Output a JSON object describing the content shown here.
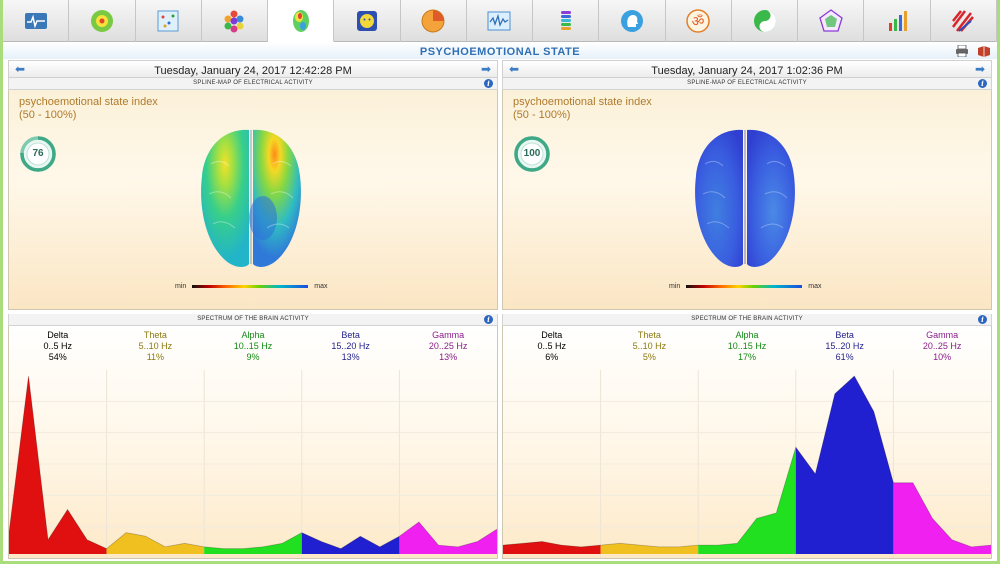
{
  "header": {
    "title": "PSYCHOEMOTIONAL STATE"
  },
  "toolbar": {
    "items": [
      {
        "icon": "ecg-monitor-icon"
      },
      {
        "icon": "aura-circle-icon"
      },
      {
        "icon": "scatter-grid-icon"
      },
      {
        "icon": "hexagon-cluster-icon"
      },
      {
        "icon": "brain-map-icon"
      },
      {
        "icon": "face-portrait-icon"
      },
      {
        "icon": "pie-chart-icon"
      },
      {
        "icon": "waveform-icon"
      },
      {
        "icon": "chakra-stack-icon"
      },
      {
        "icon": "head-profile-icon"
      },
      {
        "icon": "om-symbol-icon"
      },
      {
        "icon": "yin-yang-icon"
      },
      {
        "icon": "pentagon-star-icon"
      },
      {
        "icon": "bar-chart-icon"
      },
      {
        "icon": "pattern-icon"
      }
    ],
    "active_index": 4
  },
  "panels": [
    {
      "date": "Tuesday, January 24, 2017 12:42:28 PM",
      "map_heading": "SPLINE-MAP OF ELECTRICAL ACTIVITY",
      "index_label": "psychoemotional state index",
      "index_range": "(50 - 100%)",
      "index_value": "76",
      "index_fraction": 0.76,
      "scale_min": "min",
      "scale_max": "max",
      "spectrum_heading": "SPECTRUM OF THE BRAIN ACTIVITY",
      "bands": [
        {
          "name": "Delta",
          "range": "0..5 Hz",
          "pct": "54%",
          "color": "#000000"
        },
        {
          "name": "Theta",
          "range": "5..10 Hz",
          "pct": "11%",
          "color": "#8a7a10"
        },
        {
          "name": "Alpha",
          "range": "10..15 Hz",
          "pct": "9%",
          "color": "#138a13"
        },
        {
          "name": "Beta",
          "range": "15..20 Hz",
          "pct": "13%",
          "color": "#1e1e8a"
        },
        {
          "name": "Gamma",
          "range": "20..25 Hz",
          "pct": "13%",
          "color": "#8a1e8a"
        }
      ]
    },
    {
      "date": "Tuesday, January 24, 2017 1:02:36 PM",
      "map_heading": "SPLINE-MAP OF ELECTRICAL ACTIVITY",
      "index_label": "psychoemotional state index",
      "index_range": "(50 - 100%)",
      "index_value": "100",
      "index_fraction": 1.0,
      "scale_min": "min",
      "scale_max": "max",
      "spectrum_heading": "SPECTRUM OF THE BRAIN ACTIVITY",
      "bands": [
        {
          "name": "Delta",
          "range": "0..5 Hz",
          "pct": "6%",
          "color": "#000000"
        },
        {
          "name": "Theta",
          "range": "5..10 Hz",
          "pct": "5%",
          "color": "#8a7a10"
        },
        {
          "name": "Alpha",
          "range": "10..15 Hz",
          "pct": "17%",
          "color": "#138a13"
        },
        {
          "name": "Beta",
          "range": "15..20 Hz",
          "pct": "61%",
          "color": "#1e1e8a"
        },
        {
          "name": "Gamma",
          "range": "20..25 Hz",
          "pct": "10%",
          "color": "#8a1e8a"
        }
      ]
    }
  ],
  "chart_data": [
    {
      "type": "area",
      "x": [
        0,
        1,
        2,
        3,
        4,
        5,
        6,
        7,
        8,
        9,
        10,
        11,
        12,
        13,
        14,
        15,
        16,
        17,
        18,
        19,
        20,
        21,
        22,
        23,
        24,
        25
      ],
      "y": [
        0.12,
        1.0,
        0.08,
        0.25,
        0.08,
        0.03,
        0.12,
        0.1,
        0.04,
        0.06,
        0.04,
        0.03,
        0.03,
        0.04,
        0.06,
        0.12,
        0.07,
        0.03,
        0.1,
        0.04,
        0.1,
        0.18,
        0.05,
        0.04,
        0.07,
        0.14
      ],
      "band_colors": [
        "#e01010",
        "#f0c020",
        "#20e020",
        "#2020d0",
        "#f020f0"
      ],
      "ylim": [
        0,
        1
      ]
    },
    {
      "type": "area",
      "x": [
        0,
        1,
        2,
        3,
        4,
        5,
        6,
        7,
        8,
        9,
        10,
        11,
        12,
        13,
        14,
        15,
        16,
        17,
        18,
        19,
        20,
        21,
        22,
        23,
        24,
        25
      ],
      "y": [
        0.05,
        0.06,
        0.07,
        0.05,
        0.04,
        0.05,
        0.06,
        0.05,
        0.04,
        0.04,
        0.05,
        0.05,
        0.06,
        0.2,
        0.23,
        0.6,
        0.45,
        0.9,
        1.0,
        0.8,
        0.4,
        0.4,
        0.2,
        0.08,
        0.04,
        0.05
      ],
      "band_colors": [
        "#e01010",
        "#f0c020",
        "#20e020",
        "#2020d0",
        "#f020f0"
      ],
      "ylim": [
        0,
        1
      ]
    }
  ]
}
